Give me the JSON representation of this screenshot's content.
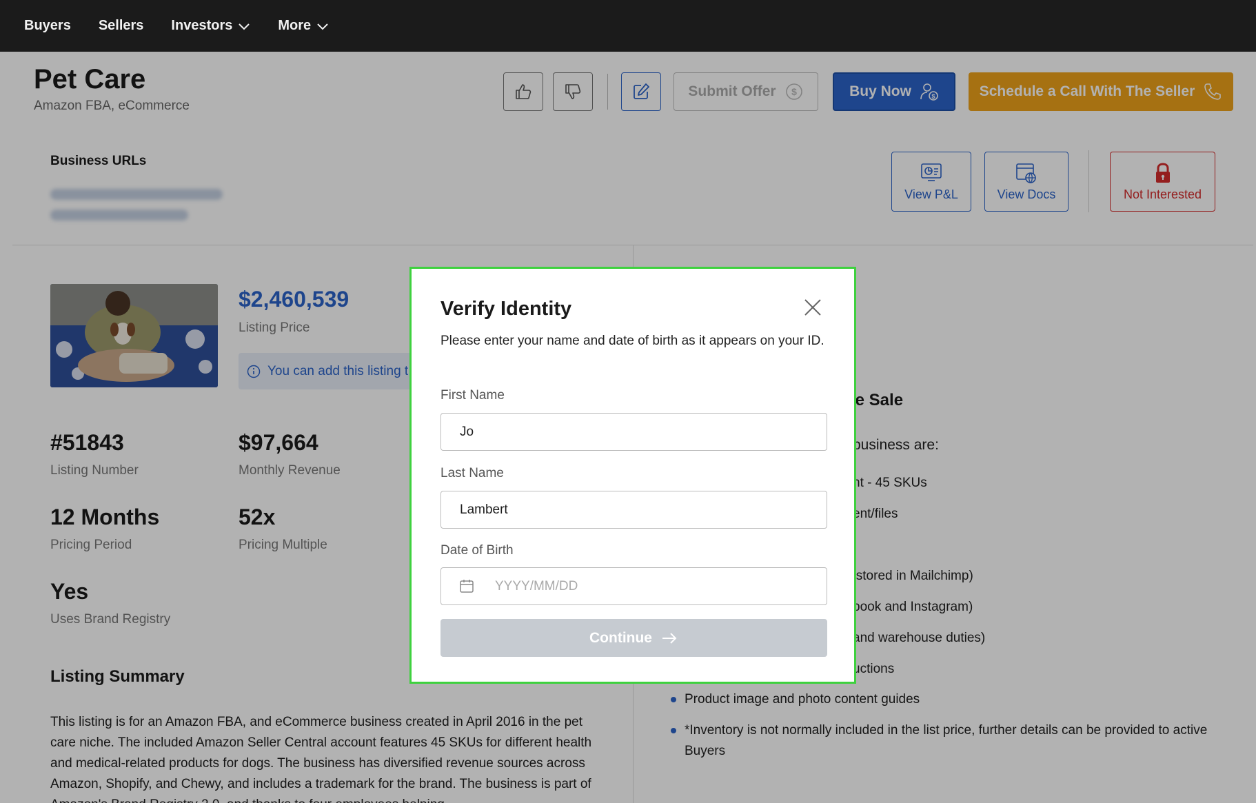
{
  "nav": {
    "items": [
      {
        "label": "Buyers"
      },
      {
        "label": "Sellers"
      },
      {
        "label": "Investors",
        "dropdown": true
      },
      {
        "label": "More",
        "dropdown": true
      }
    ]
  },
  "header": {
    "title": "Pet Care",
    "subtitle": "Amazon FBA, eCommerce",
    "submit_offer_label": "Submit Offer",
    "buy_now_label": "Buy Now",
    "schedule_label": "Schedule a Call With The Seller"
  },
  "urls": {
    "label": "Business URLs",
    "view_pl_label": "View P&L",
    "view_docs_label": "View Docs",
    "not_interested_label": "Not Interested"
  },
  "listing": {
    "price": "$2,460,539",
    "price_label": "Listing Price",
    "info_text": "You can add this listing t",
    "number": "#51843",
    "number_label": "Listing Number",
    "monthly_revenue": "$97,664",
    "monthly_revenue_label": "Monthly Revenue",
    "pricing_period": "12 Months",
    "pricing_period_label": "Pricing Period",
    "pricing_multiple": "52x",
    "pricing_multiple_label": "Pricing Multiple",
    "brand_registry": "Yes",
    "brand_registry_label": "Uses Brand Registry",
    "summary_heading": "Listing Summary",
    "summary_text": "This listing is for an Amazon FBA, and eCommerce business created in April 2016 in the pet care niche. The included Amazon Seller Central account features 45 SKUs for different health and medical-related products for dogs. The business has diversified revenue sources across Amazon, Shopify, and Chewy, and includes a trademark for the brand. The business is part of Amazon's Brand Registry 2.0, and thanks to four employees helping"
  },
  "sale": {
    "heading_fragment": "he Sale",
    "intro_fragment": "business are:",
    "items": [
      "nt - 45 SKUs",
      "ent/files",
      "s stored in Mailchimp)",
      "book and Instagram)",
      "and warehouse duties)",
      "uctions"
    ],
    "bullets": [
      "Product image and photo content guides",
      "*Inventory is not normally included in the list price, further details can be provided to active Buyers"
    ]
  },
  "modal": {
    "title": "Verify Identity",
    "description": "Please enter your name and date of birth as it appears on your ID.",
    "first_name_label": "First Name",
    "first_name_value": "Jo",
    "last_name_label": "Last Name",
    "last_name_value": "Lambert",
    "dob_label": "Date of Birth",
    "dob_placeholder": "YYYY/MM/DD",
    "continue_label": "Continue"
  },
  "colors": {
    "primary_blue": "#2c64c9",
    "orange": "#eea21a",
    "danger_red": "#d42b2b",
    "modal_highlight": "#3ed13e",
    "nav_bg": "#1b1b1b"
  },
  "icons": {
    "thumbs_up": "thumbs-up-icon",
    "thumbs_down": "thumbs-down-icon",
    "edit": "edit-icon",
    "dollar": "dollar-circle-icon",
    "buyer": "user-dollar-icon",
    "phone": "phone-icon",
    "pl": "monitor-chart-icon",
    "docs": "web-document-icon",
    "lock": "lock-icon",
    "close": "close-icon",
    "calendar": "calendar-icon",
    "arrow": "arrow-right-icon",
    "info": "info-icon",
    "chevron": "chevron-down-icon"
  }
}
